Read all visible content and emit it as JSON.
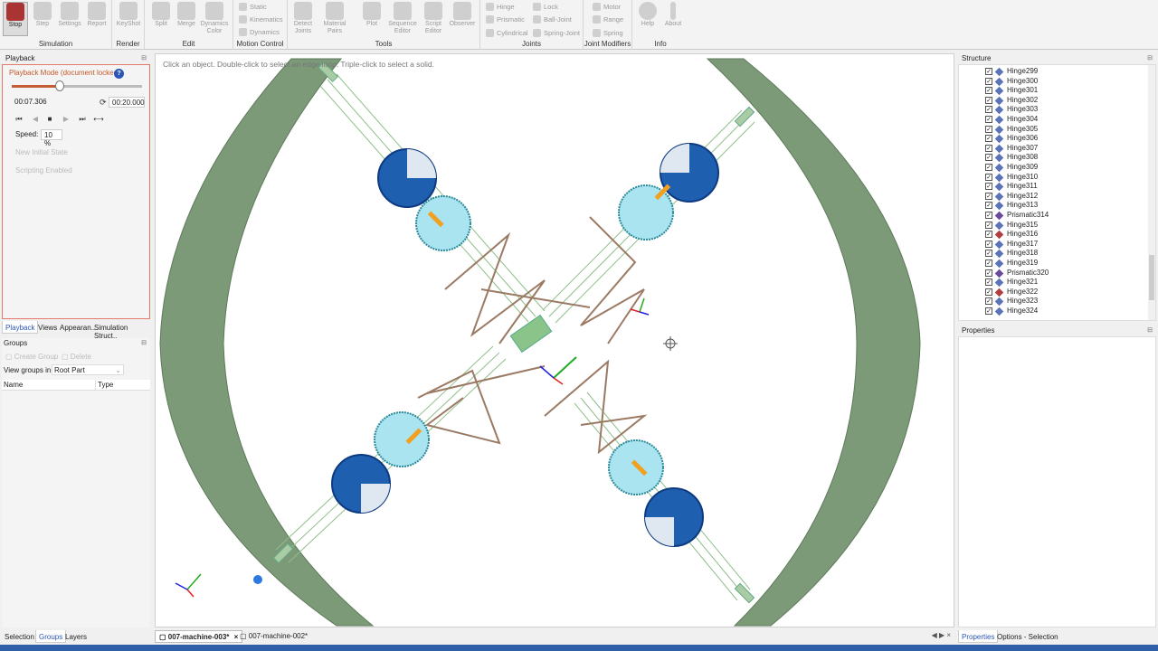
{
  "ribbon": {
    "groups": [
      {
        "label": "Simulation",
        "buttons": [
          "Stop",
          "Step",
          "Settings",
          "Report"
        ]
      },
      {
        "label": "Render",
        "buttons": [
          "KeyShot"
        ]
      },
      {
        "label": "Edit",
        "buttons": [
          "Split",
          "Merge",
          "Dynamics Color"
        ]
      },
      {
        "label": "Motion Control",
        "items": [
          "Static",
          "Kinematics",
          "Dynamics"
        ]
      },
      {
        "label": "Tools",
        "buttons": [
          "Detect Joints",
          "Material Pairs",
          "Plot",
          "Sequence Editor",
          "Script Editor",
          "Observer"
        ]
      },
      {
        "label": "Joints",
        "items": [
          "Hinge",
          "Prismatic",
          "Cylindrical",
          "Lock",
          "Ball-Joint",
          "Spring-Joint"
        ]
      },
      {
        "label": "Joint Modifiers",
        "items": [
          "Motor",
          "Range",
          "Spring"
        ]
      },
      {
        "label": "Info",
        "buttons": [
          "Help",
          "About"
        ]
      }
    ]
  },
  "playback": {
    "title": "Playback",
    "mode": "Playback Mode (document locked)",
    "current_time": "00:07.306",
    "end_time": "00:20.000",
    "progress": 0.365,
    "speed_label": "Speed:",
    "speed": "10 %",
    "new_initial_state": "New Initial State",
    "scripting_enabled": "Scripting Enabled"
  },
  "left_tabs": [
    "Playback",
    "Views",
    "Appearan..",
    "Simulation Struct.."
  ],
  "groups": {
    "title": "Groups",
    "create": "Create Group",
    "delete": "Delete",
    "view_in_label": "View groups in:",
    "view_in_value": "Root Part",
    "col_name": "Name",
    "col_type": "Type"
  },
  "bottom_left_tabs": [
    "Selection",
    "Groups",
    "Layers"
  ],
  "viewport": {
    "hint": "Click an object. Double-click to select an edge loop. Triple-click to select a solid."
  },
  "doc_tabs": [
    "007-machine-003*",
    "007-machine-002*"
  ],
  "structure": {
    "title": "Structure",
    "items": [
      {
        "label": "Hinge299",
        "kind": "hinge"
      },
      {
        "label": "Hinge300",
        "kind": "hinge"
      },
      {
        "label": "Hinge301",
        "kind": "hinge"
      },
      {
        "label": "Hinge302",
        "kind": "hinge"
      },
      {
        "label": "Hinge303",
        "kind": "hinge"
      },
      {
        "label": "Hinge304",
        "kind": "hinge"
      },
      {
        "label": "Hinge305",
        "kind": "hinge"
      },
      {
        "label": "Hinge306",
        "kind": "hinge"
      },
      {
        "label": "Hinge307",
        "kind": "hinge"
      },
      {
        "label": "Hinge308",
        "kind": "hinge"
      },
      {
        "label": "Hinge309",
        "kind": "hinge"
      },
      {
        "label": "Hinge310",
        "kind": "hinge"
      },
      {
        "label": "Hinge311",
        "kind": "hinge"
      },
      {
        "label": "Hinge312",
        "kind": "hinge"
      },
      {
        "label": "Hinge313",
        "kind": "hinge"
      },
      {
        "label": "Prismatic314",
        "kind": "prismatic"
      },
      {
        "label": "Hinge315",
        "kind": "hinge"
      },
      {
        "label": "Hinge316",
        "kind": "hinge-red"
      },
      {
        "label": "Hinge317",
        "kind": "hinge"
      },
      {
        "label": "Hinge318",
        "kind": "hinge"
      },
      {
        "label": "Hinge319",
        "kind": "hinge"
      },
      {
        "label": "Prismatic320",
        "kind": "prismatic"
      },
      {
        "label": "Hinge321",
        "kind": "hinge"
      },
      {
        "label": "Hinge322",
        "kind": "hinge-red"
      },
      {
        "label": "Hinge323",
        "kind": "hinge"
      },
      {
        "label": "Hinge324",
        "kind": "hinge"
      }
    ]
  },
  "properties": {
    "title": "Properties"
  },
  "bottom_right_tabs": [
    "Properties",
    "Options - Selection"
  ],
  "colors": {
    "accent": "#2a56b8",
    "playback_mode": "#c55a2a",
    "ring": "#7c9a78",
    "disc": "#1f5fb0"
  }
}
